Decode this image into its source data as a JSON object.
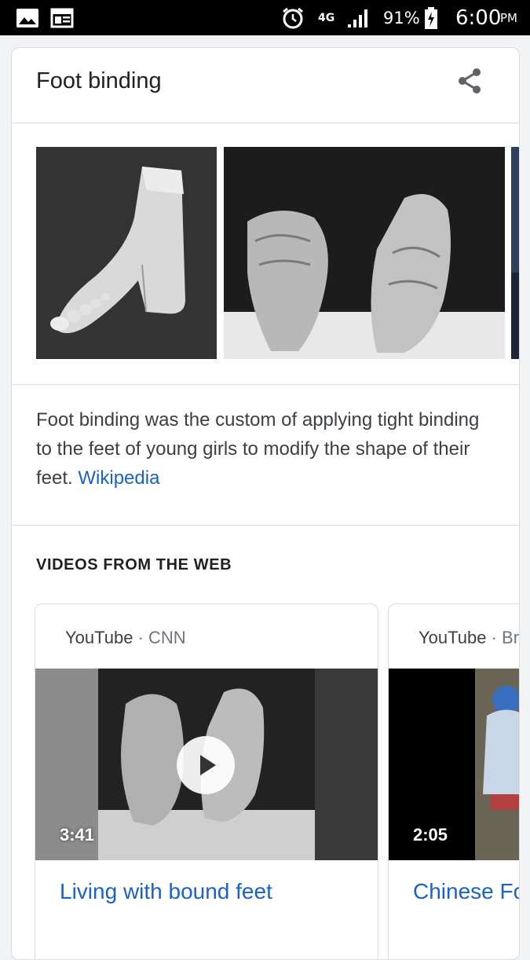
{
  "status_bar": {
    "icons": [
      "image-icon",
      "news-icon",
      "alarm-icon",
      "signal-icon",
      "battery-charging-icon"
    ],
    "network": "4G",
    "battery": "91%",
    "time": "6:00",
    "ampm": "PM"
  },
  "card": {
    "title": "Foot binding",
    "share_icon": "share-icon",
    "description": "Foot binding was the custom of applying tight binding to the feet of young girls to modify the shape of their feet.",
    "source_link": "Wikipedia"
  },
  "videos_section": {
    "heading": "VIDEOS FROM THE WEB",
    "items": [
      {
        "platform": "YouTube",
        "separator": " · ",
        "channel": "CNN",
        "duration": "3:41",
        "title": "Living with bound feet"
      },
      {
        "platform": "YouTube",
        "separator": " · ",
        "channel": "Bree",
        "duration": "2:05",
        "title": "Chinese Fo"
      }
    ]
  },
  "colors": {
    "link": "#1a62c7",
    "text": "#202124",
    "divider": "#dadce0"
  }
}
